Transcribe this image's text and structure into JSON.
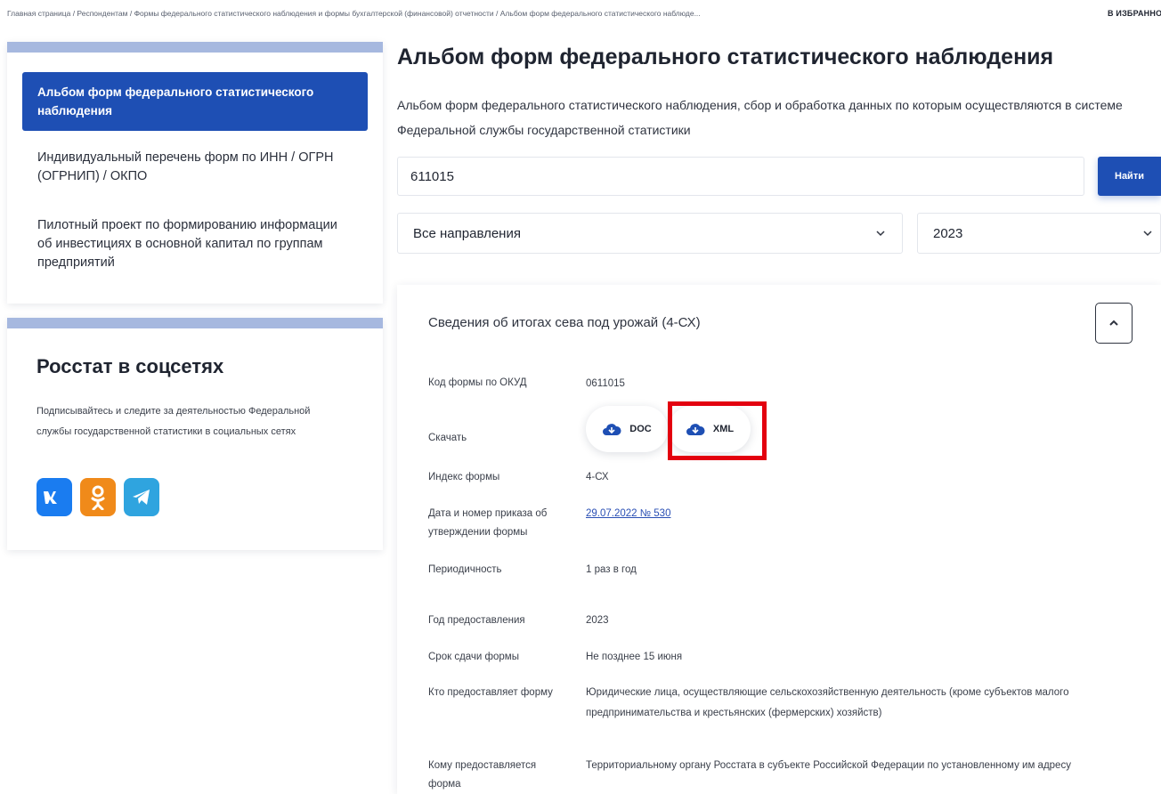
{
  "breadcrumb": "Главная страница / Респондентам / Формы федерального статистического наблюдения и формы бухгалтерской (финансовой) отчетности / Альбом форм федерального статистического наблюде...",
  "favorites_label": "В ИЗБРАННОЕ",
  "sidebar": {
    "items": [
      {
        "label": "Альбом форм федерального статистического наблюдения",
        "active": true
      },
      {
        "label": "Индивидуальный перечень форм по ИНН / ОГРН (ОГРНИП) / ОКПО",
        "active": false
      },
      {
        "label": "Пилотный проект по формированию информации об инвестициях в основной капитал по группам предприятий",
        "active": false
      }
    ]
  },
  "social": {
    "title": "Росстат в соцсетях",
    "description": "Подписывайтесь и следите за деятельностью Федеральной службы государственной статистики в социальных сетях",
    "icons": [
      "vk-icon",
      "ok-icon",
      "telegram-icon"
    ]
  },
  "main": {
    "title": "Альбом форм федерального статистического наблюдения",
    "description": "Альбом форм федерального статистического наблюдения, сбор и обработка данных по которым осуществляются в системе Федеральной службы государственной статистики",
    "search_value": "611015",
    "search_button": "Найти",
    "direction_select": "Все направления",
    "year_select": "2023"
  },
  "form": {
    "title": "Сведения об итогах сева под урожай (4-СХ)",
    "rows": {
      "okud_label": "Код формы по ОКУД",
      "okud_value": "0611015",
      "download_label": "Скачать",
      "doc_label": "DOC",
      "xml_label": "XML",
      "index_label": "Индекс формы",
      "index_value": "4-СХ",
      "order_label": "Дата и номер приказа об утверждении формы",
      "order_value": "29.07.2022 № 530",
      "period_label": "Периодичность",
      "period_value": "1 раз в год",
      "year_label": "Год предоставления",
      "year_value": "2023",
      "deadline_label": "Срок сдачи формы",
      "deadline_value": "Не позднее 15 июня",
      "who_label": "Кто предоставляет форму",
      "who_value": "Юридические лица, осуществляющие сельскохозяйственную деятельность (кроме субъектов малого предпринимательства и крестьянских (фермерских) хозяйств)",
      "to_whom_label": "Кому предоставляется форма",
      "to_whom_value": "Территориальному органу Росстата в субъекте Российской Федерации по установленному им адресу"
    }
  },
  "colors": {
    "accent": "#1e4fb4",
    "highlight": "#e3000f",
    "sidebar_bar": "#a6b8df"
  }
}
